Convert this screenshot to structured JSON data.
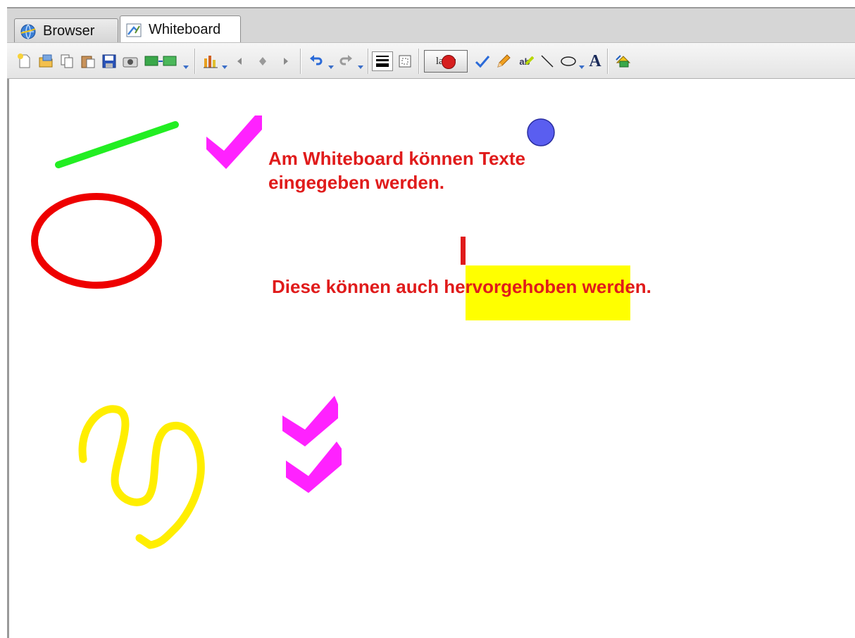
{
  "tabs": [
    {
      "label": "Browser",
      "icon": "globe-icon",
      "active": false
    },
    {
      "label": "Whiteboard",
      "icon": "whiteboard-icon",
      "active": true
    }
  ],
  "toolbar": {
    "laser_label": "laser",
    "text_tool_glyph": "A",
    "highlighter_glyph": "ab"
  },
  "whiteboard": {
    "text_line1": "Am Whiteboard können Texte",
    "text_line2": "eingegeben werden.",
    "text_before_highlight": "Diese können auch ",
    "text_highlighted": "hervorgehoben",
    "text_after_highlight": " werden.",
    "cursor_glyph": "I"
  },
  "colors": {
    "text": "#e01b1b",
    "highlight": "#ffff00",
    "green_line": "#22ee22",
    "red_ellipse": "#ee0000",
    "magenta_check": "#ff22ff",
    "blue_circle": "#5a5ef0",
    "yellow_scribble": "#ffee00"
  }
}
